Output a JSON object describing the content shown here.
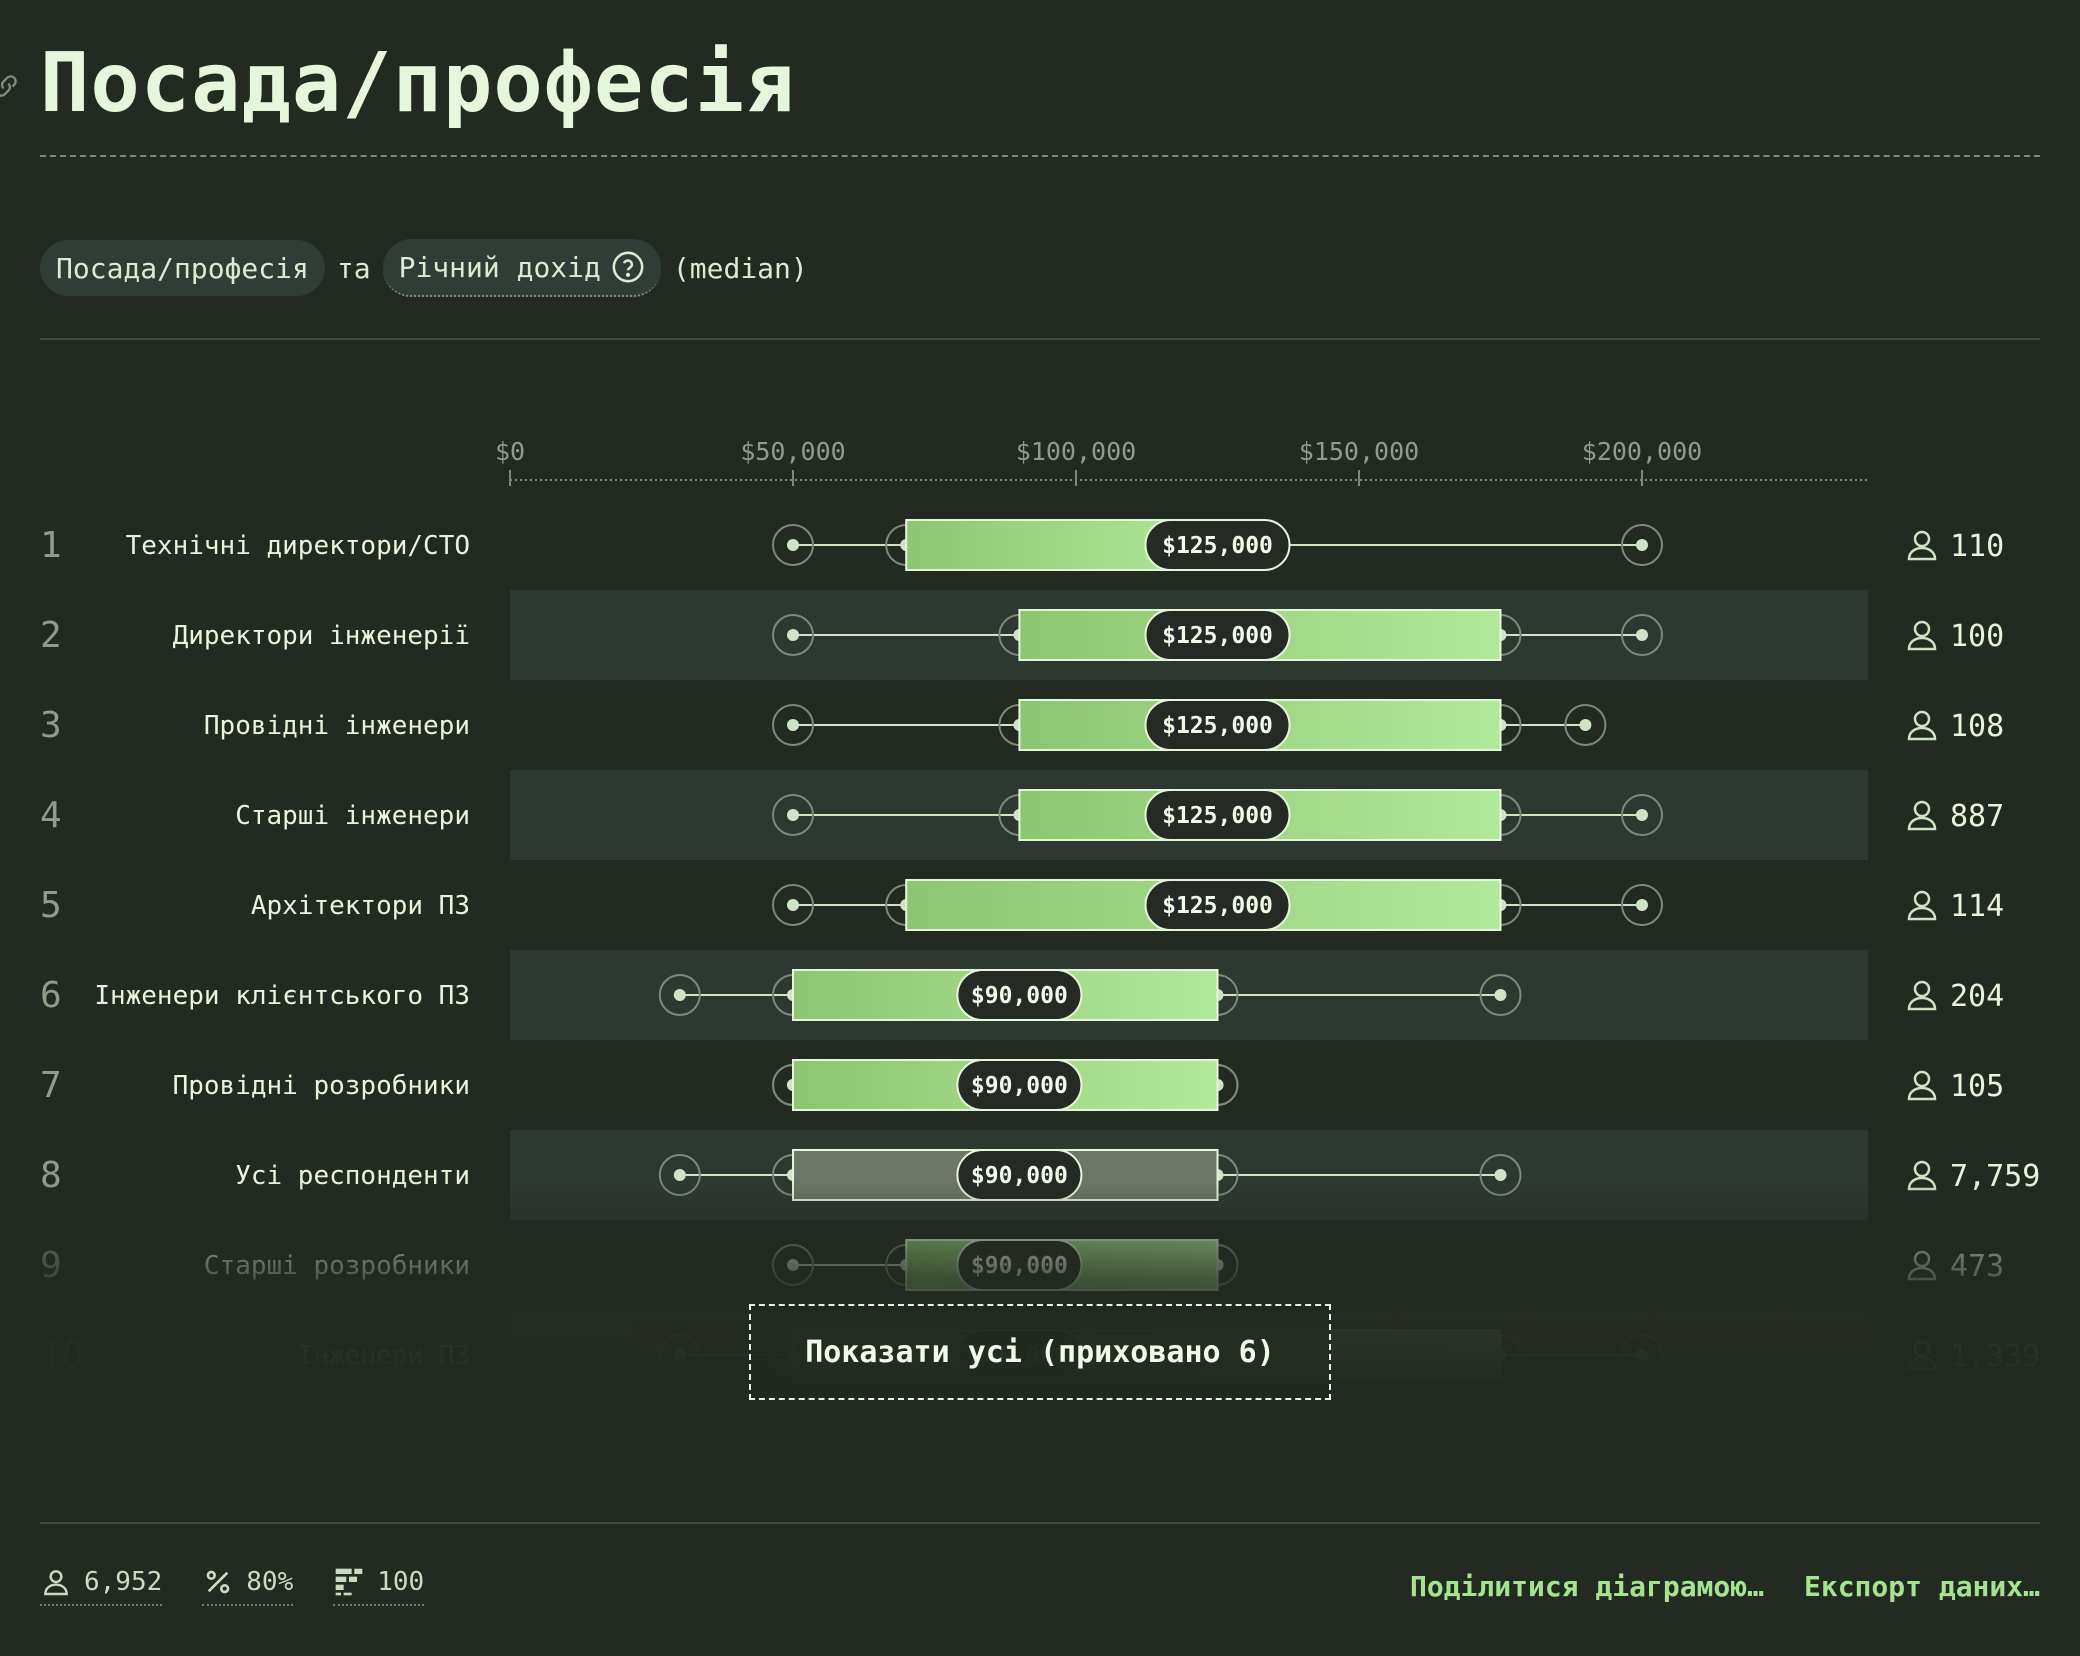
{
  "header": {
    "title": "Посада/професія"
  },
  "query": {
    "field": "Посада/професія",
    "connector": "та",
    "metric": "Річний дохід",
    "aggregate": "(median)"
  },
  "show_all_label": "Показати усі (приховано 6)",
  "footer": {
    "respondents": "6,952",
    "percent": "80%",
    "limit": "100",
    "share_label": "Поділитися діаграмою…",
    "export_label": "Експорт даних…"
  },
  "colors": {
    "background": "#232a21",
    "text": "#e6f6dd",
    "box_green_start": "#8dc672",
    "box_green_end": "#b2e89a",
    "overall_box": "#6c7767",
    "median_pill": "#252a25",
    "band": "#2d3831",
    "accent": "#a6e390"
  },
  "chart_data": {
    "type": "box",
    "x_ticks": [
      "$0",
      "$50,000",
      "$100,000",
      "$150,000",
      "$200,000"
    ],
    "xlim": [
      0,
      240000
    ],
    "rows": [
      {
        "rank": "1",
        "label": "Технічні директори/CTO",
        "min": 50000,
        "q1": 70000,
        "median": 125000,
        "q3": 125000,
        "max": 200000,
        "median_label": "$125,000",
        "count": "110"
      },
      {
        "rank": "2",
        "label": "Директори інженерії",
        "min": 50000,
        "q1": 90000,
        "median": 125000,
        "q3": 175000,
        "max": 200000,
        "median_label": "$125,000",
        "count": "100"
      },
      {
        "rank": "3",
        "label": "Провідні інженери",
        "min": 50000,
        "q1": 90000,
        "median": 125000,
        "q3": 175000,
        "max": 190000,
        "median_label": "$125,000",
        "count": "108"
      },
      {
        "rank": "4",
        "label": "Старші інженери",
        "min": 50000,
        "q1": 90000,
        "median": 125000,
        "q3": 175000,
        "max": 200000,
        "median_label": "$125,000",
        "count": "887"
      },
      {
        "rank": "5",
        "label": "Архітектори ПЗ",
        "min": 50000,
        "q1": 70000,
        "median": 125000,
        "q3": 175000,
        "max": 200000,
        "median_label": "$125,000",
        "count": "114"
      },
      {
        "rank": "6",
        "label": "Інженери клієнтського ПЗ",
        "min": 30000,
        "q1": 50000,
        "median": 90000,
        "q3": 125000,
        "max": 175000,
        "median_label": "$90,000",
        "count": "204"
      },
      {
        "rank": "7",
        "label": "Провідні розробники",
        "min": 50000,
        "q1": 50000,
        "median": 90000,
        "q3": 125000,
        "max": 125000,
        "median_label": "$90,000",
        "count": "105"
      },
      {
        "rank": "8",
        "label": "Усі респонденти",
        "min": 30000,
        "q1": 50000,
        "median": 90000,
        "q3": 125000,
        "max": 175000,
        "median_label": "$90,000",
        "count": "7,759",
        "overall": true
      },
      {
        "rank": "9",
        "label": "Старші розробники",
        "min": 50000,
        "q1": 70000,
        "median": 90000,
        "q3": 125000,
        "max": 125000,
        "median_label": "$90,000",
        "count": "473"
      },
      {
        "rank": "10",
        "label": "Інженери ПЗ",
        "min": 30000,
        "q1": 50000,
        "median": 90000,
        "q3": 175000,
        "max": 200000,
        "median_label": "$90,000",
        "count": "1,339"
      }
    ]
  }
}
